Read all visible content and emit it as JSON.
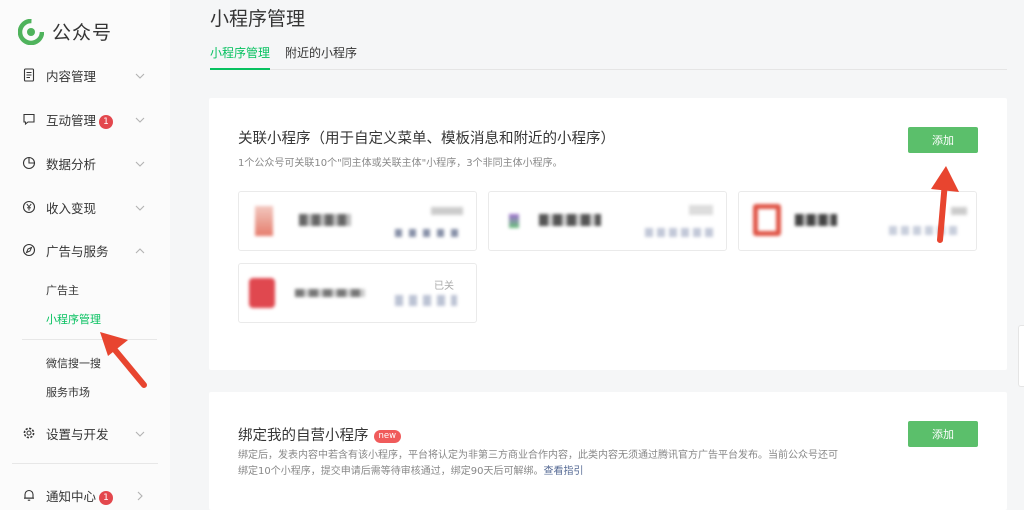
{
  "sidebar": {
    "logo_text": "公众号",
    "items": [
      {
        "label": "内容管理",
        "icon": "document-icon"
      },
      {
        "label": "互动管理",
        "icon": "chat-icon",
        "badge": "1"
      },
      {
        "label": "数据分析",
        "icon": "pie-chart-icon"
      },
      {
        "label": "收入变现",
        "icon": "yen-icon"
      },
      {
        "label": "广告与服务",
        "icon": "compass-icon",
        "expanded": true
      },
      {
        "label": "设置与开发",
        "icon": "gear-icon"
      }
    ],
    "sub_items": [
      "广告主",
      "小程序管理",
      "微信搜一搜",
      "服务市场"
    ],
    "active_sub": "小程序管理",
    "notification": {
      "label": "通知中心",
      "badge": "1"
    }
  },
  "header": {
    "title": "小程序管理",
    "tabs": [
      "小程序管理",
      "附近的小程序"
    ],
    "active_tab": "小程序管理"
  },
  "linked_card": {
    "title": "关联小程序（用于自定义菜单、模板消息和附近的小程序）",
    "desc": "1个公众号可关联10个\"同主体或关联主体\"小程序，3个非同主体小程序。",
    "add_label": "添加",
    "programs": [
      {
        "status": ""
      },
      {
        "status": ""
      },
      {
        "status": ""
      },
      {
        "status": "已关"
      }
    ]
  },
  "bind_card": {
    "title": "绑定我的自营小程序",
    "new_label": "new",
    "desc_line1": "绑定后，发表内容中若含有该小程序，平台将认定为非第三方商业合作内容，此类内容无须通过腾讯官方广告平台发布。当前公众号还可",
    "desc_line2": "绑定10个小程序，提交申请后需等待审核通过，绑定90天后可解绑。",
    "guide_link": "查看指引",
    "add_label": "添加"
  },
  "colors": {
    "accent": "#07c160",
    "button": "#5bbf6b",
    "badge": "#e3474d",
    "annotation_arrow": "#e8452f"
  }
}
